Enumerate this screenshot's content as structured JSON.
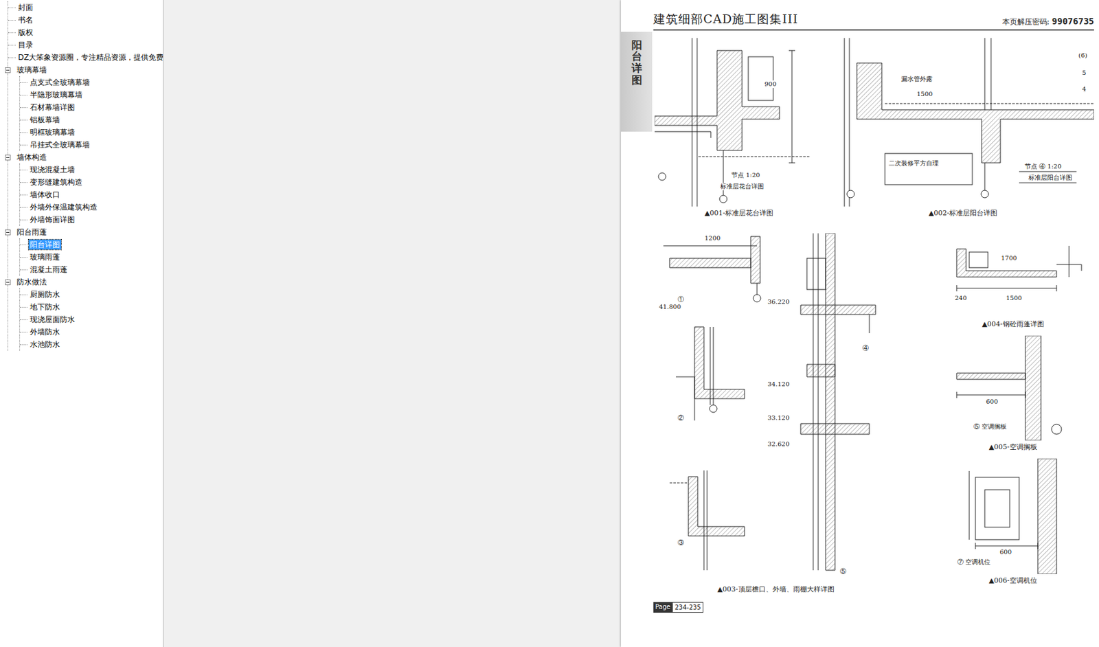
{
  "sidebar": {
    "items": [
      {
        "label": "封面",
        "kind": "leaf",
        "selected": false
      },
      {
        "label": "书名",
        "kind": "leaf",
        "selected": false
      },
      {
        "label": "版权",
        "kind": "leaf",
        "selected": false
      },
      {
        "label": "目录",
        "kind": "leaf",
        "selected": false
      },
      {
        "label": "DZ大笨象资源圈，专注精品资源，提供免费",
        "kind": "leaf",
        "selected": false
      },
      {
        "label": "玻璃幕墙",
        "kind": "group",
        "expanded": true,
        "selected": false,
        "children": [
          {
            "label": "点支式全玻璃幕墙",
            "selected": false
          },
          {
            "label": "半隐形玻璃幕墙",
            "selected": false
          },
          {
            "label": "石材幕墙详图",
            "selected": false
          },
          {
            "label": "铝板幕墙",
            "selected": false
          },
          {
            "label": "明框玻璃幕墙",
            "selected": false
          },
          {
            "label": "吊挂式全玻璃幕墙",
            "selected": false
          }
        ]
      },
      {
        "label": "墙体构造",
        "kind": "group",
        "expanded": true,
        "selected": false,
        "children": [
          {
            "label": "现浇混凝土墙",
            "selected": false
          },
          {
            "label": "变形缝建筑构造",
            "selected": false
          },
          {
            "label": "墙体收口",
            "selected": false
          },
          {
            "label": "外墙外保温建筑构造",
            "selected": false
          },
          {
            "label": "外墙饰面详图",
            "selected": false
          }
        ]
      },
      {
        "label": "阳台雨蓬",
        "kind": "group",
        "expanded": true,
        "selected": false,
        "children": [
          {
            "label": "阳台详图",
            "selected": true
          },
          {
            "label": "玻璃雨蓬",
            "selected": false
          },
          {
            "label": "混凝土雨蓬",
            "selected": false
          }
        ]
      },
      {
        "label": "防水做法",
        "kind": "group",
        "expanded": true,
        "selected": false,
        "children": [
          {
            "label": "厨厕防水",
            "selected": false
          },
          {
            "label": "地下防水",
            "selected": false
          },
          {
            "label": "现浇屋面防水",
            "selected": false
          },
          {
            "label": "外墙防水",
            "selected": false
          },
          {
            "label": "水池防水",
            "selected": false
          }
        ]
      }
    ]
  },
  "page": {
    "title": "建筑细部CAD施工图集III",
    "password_label": "本页解压密码:",
    "password": "99076735",
    "tab": "阳台详图",
    "figures": [
      {
        "caption": "▲001-标准层花台详图",
        "labels": [
          "900",
          "节点 1:20",
          "标准层花台详图"
        ]
      },
      {
        "caption": "▲002-标准层阳台详图",
        "labels": [
          "漏水管外露",
          "1500",
          "二次装修平方自理",
          "节点 ④ 1:20",
          "标准层阳台详图",
          "(6)",
          "5",
          "4"
        ]
      },
      {
        "caption": "▲003-顶层檐口、外墙、雨棚大样详图",
        "labels": [
          "①",
          "②",
          "③",
          "④",
          "⑤",
          "1200",
          "41.800",
          "36.220",
          "34.120",
          "33.120",
          "32.620"
        ]
      },
      {
        "caption": "▲004-钢砼雨蓬详图",
        "labels": [
          "1700",
          "1500",
          "240"
        ]
      },
      {
        "caption": "▲005-空调搁板",
        "labels": [
          "⑤ 空调搁板",
          "600"
        ]
      },
      {
        "caption": "▲006-空调机位",
        "labels": [
          "⑦ 空调机位",
          "600"
        ]
      }
    ],
    "page_number_label": "Page",
    "page_number": "234-235"
  }
}
